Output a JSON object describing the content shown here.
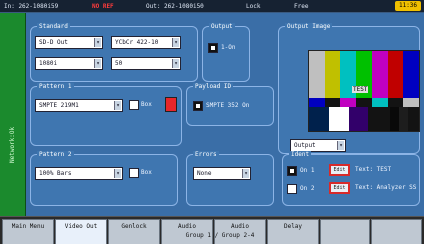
{
  "statusbar": {
    "input": "In: 262-1080i59",
    "warn": "NO REF",
    "output": "Out: 262-1080i50",
    "lock": "Lock",
    "state": "Free",
    "clock": "11:36"
  },
  "sidebar": {
    "label": "Network:Ok"
  },
  "standard": {
    "title": "Standard",
    "rows": [
      [
        "SD-D Out",
        "YCbCr 422-10"
      ],
      [
        "1080i",
        "50"
      ]
    ]
  },
  "output": {
    "title": "Output",
    "item": "1-On"
  },
  "output_image": {
    "title": "Output Image",
    "overlay_label": "TEST",
    "select": "Output"
  },
  "pattern1": {
    "title": "Pattern 1",
    "select": "SMPTE 219M1",
    "option": "Box"
  },
  "payload_id": {
    "title": "Payload ID",
    "value": "SMPTE 352 On"
  },
  "pattern2": {
    "title": "Pattern 2",
    "select": "100% Bars",
    "option": "Box"
  },
  "errors": {
    "title": "Errors",
    "select": "None"
  },
  "ident": {
    "title": "Ident",
    "row1": "On 1",
    "row2": "On 2",
    "edit_label": "Edit",
    "text1": "Text: TEST",
    "text2": "Text: Analyzer SS"
  },
  "tabs": [
    "Main Menu",
    "Video Out",
    "Genlock",
    "Audio",
    "Audio",
    "Delay",
    "",
    ""
  ],
  "group_info": "Group 1 / Group 2-4",
  "colors": {
    "background": "#3a6ea7",
    "sidebar": "#1b8a2d",
    "accent_red": "#e8262a",
    "clock": "#f0c000"
  }
}
